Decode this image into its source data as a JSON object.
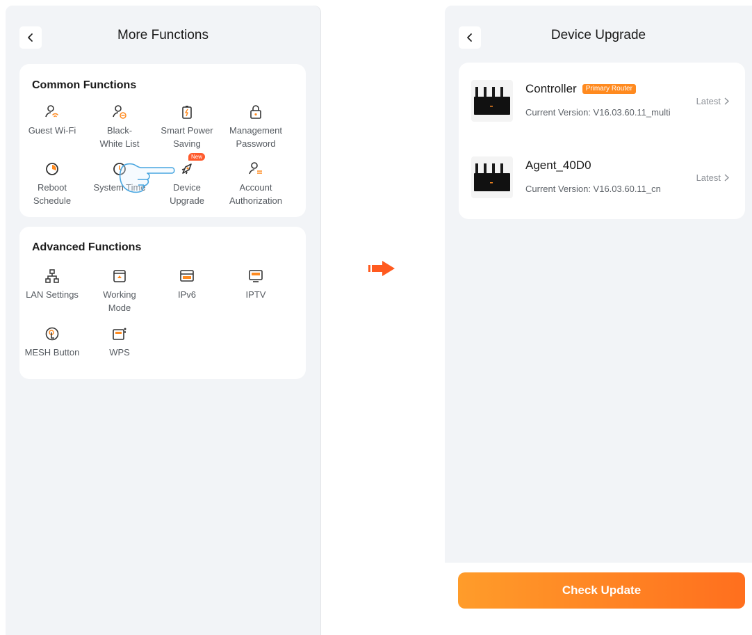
{
  "left_screen": {
    "title": "More Functions",
    "common": {
      "title": "Common Functions",
      "items": [
        {
          "label": "Guest Wi-Fi",
          "icon": "guest-wifi-icon"
        },
        {
          "label": "Black-\nWhite List",
          "icon": "black-white-list-icon"
        },
        {
          "label": "Smart Power\nSaving",
          "icon": "smart-power-saving-icon"
        },
        {
          "label": "Management\nPassword",
          "icon": "lock-icon"
        },
        {
          "label": "Reboot\nSchedule",
          "icon": "reboot-schedule-icon"
        },
        {
          "label": "System Time",
          "icon": "clock-icon"
        },
        {
          "label": "Device\nUpgrade",
          "icon": "rocket-icon",
          "badge": "New"
        },
        {
          "label": "Account\nAuthorization",
          "icon": "account-authorization-icon"
        }
      ]
    },
    "advanced": {
      "title": "Advanced Functions",
      "items": [
        {
          "label": "LAN Settings",
          "icon": "lan-icon"
        },
        {
          "label": "Working\nMode",
          "icon": "working-mode-icon"
        },
        {
          "label": "IPv6",
          "icon": "ipv6-icon"
        },
        {
          "label": "IPTV",
          "icon": "iptv-icon"
        },
        {
          "label": "MESH Button",
          "icon": "mesh-button-icon"
        },
        {
          "label": "WPS",
          "icon": "wps-icon"
        }
      ]
    }
  },
  "right_screen": {
    "title": "Device Upgrade",
    "devices": [
      {
        "name": "Controller",
        "tag": "Primary Router",
        "version": "Current Version: V16.03.60.11_multi",
        "status": "Latest"
      },
      {
        "name": "Agent_40D0",
        "tag": "",
        "version": "Current Version: V16.03.60.11_cn",
        "status": "Latest"
      }
    ],
    "check_button": "Check Update"
  },
  "colors": {
    "accent": "#ff7a1f",
    "icon_orange": "#ff8a1f",
    "background": "#f2f4f7",
    "arrow": "#ff5a1f"
  }
}
